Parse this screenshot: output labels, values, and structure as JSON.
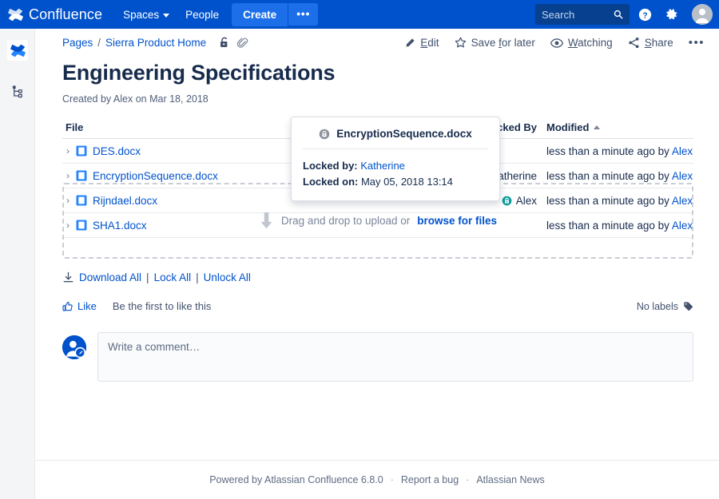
{
  "topnav": {
    "brand": "Confluence",
    "spaces": "Spaces",
    "people": "People",
    "create": "Create",
    "more": "•••",
    "search_placeholder": "Search",
    "brand_color": "#0052CC",
    "search_bg": "#06408F"
  },
  "breadcrumb": {
    "pages": "Pages",
    "separator": "/",
    "space": "Sierra Product Home"
  },
  "page_actions": [
    {
      "label_pre": "",
      "key": "E",
      "label_post": "dit",
      "icon": "pencil-icon"
    },
    {
      "label_pre": "Save ",
      "key": "f",
      "label_post": "or later",
      "icon": "star-icon"
    },
    {
      "label_pre": "",
      "key": "W",
      "label_post": "atching",
      "icon": "eye-icon"
    },
    {
      "label_pre": "",
      "key": "S",
      "label_post": "hare",
      "icon": "share-icon"
    }
  ],
  "page": {
    "title": "Engineering Specifications",
    "byline": "Created by Alex on Mar 18, 2018"
  },
  "table": {
    "headers": {
      "file": "File",
      "locked_by": "Locked By",
      "modified": "Modified"
    },
    "sort": "ascending",
    "rows": [
      {
        "name": "DES.docx",
        "locked_by": "",
        "lock_state": "none",
        "modified": "less than a minute ago by ",
        "modified_by": "Alex"
      },
      {
        "name": "EncryptionSequence.docx",
        "locked_by": "Katherine",
        "lock_state": "gray",
        "modified": "less than a minute ago by ",
        "modified_by": "Alex"
      },
      {
        "name": "Rijndael.docx",
        "locked_by": "Alex",
        "lock_state": "teal",
        "modified": "less than a minute ago by ",
        "modified_by": "Alex"
      },
      {
        "name": "SHA1.docx",
        "locked_by": "",
        "lock_state": "none",
        "modified": "less than a minute ago by ",
        "modified_by": "Alex"
      }
    ]
  },
  "dropzone": {
    "text": "Drag and drop to upload or",
    "link": "browse for files"
  },
  "bulk_actions": {
    "download_all": "Download All",
    "pipe1": "|",
    "lock_all": "Lock All",
    "pipe2": "|",
    "unlock_all": "Unlock All"
  },
  "like_row": {
    "like": "Like",
    "hint": "Be the first to like this",
    "labels": "No labels"
  },
  "comment": {
    "placeholder": "Write a comment…"
  },
  "popup": {
    "title": "EncryptionSequence.docx",
    "locked_by_label": "Locked by:",
    "locked_by_value": "Katherine",
    "locked_on_label": "Locked on:",
    "locked_on_value": "May 05, 2018 13:14",
    "lock_color": "#8C929C"
  },
  "footer": {
    "powered": "Powered by Atlassian Confluence 6.8.0",
    "dot1": "·",
    "report": "Report a bug",
    "dot2": "·",
    "news": "Atlassian News"
  },
  "colors": {
    "link": "#0052CC",
    "teal_lock": "#0C9B9B",
    "gray_lock": "#8C929C"
  }
}
